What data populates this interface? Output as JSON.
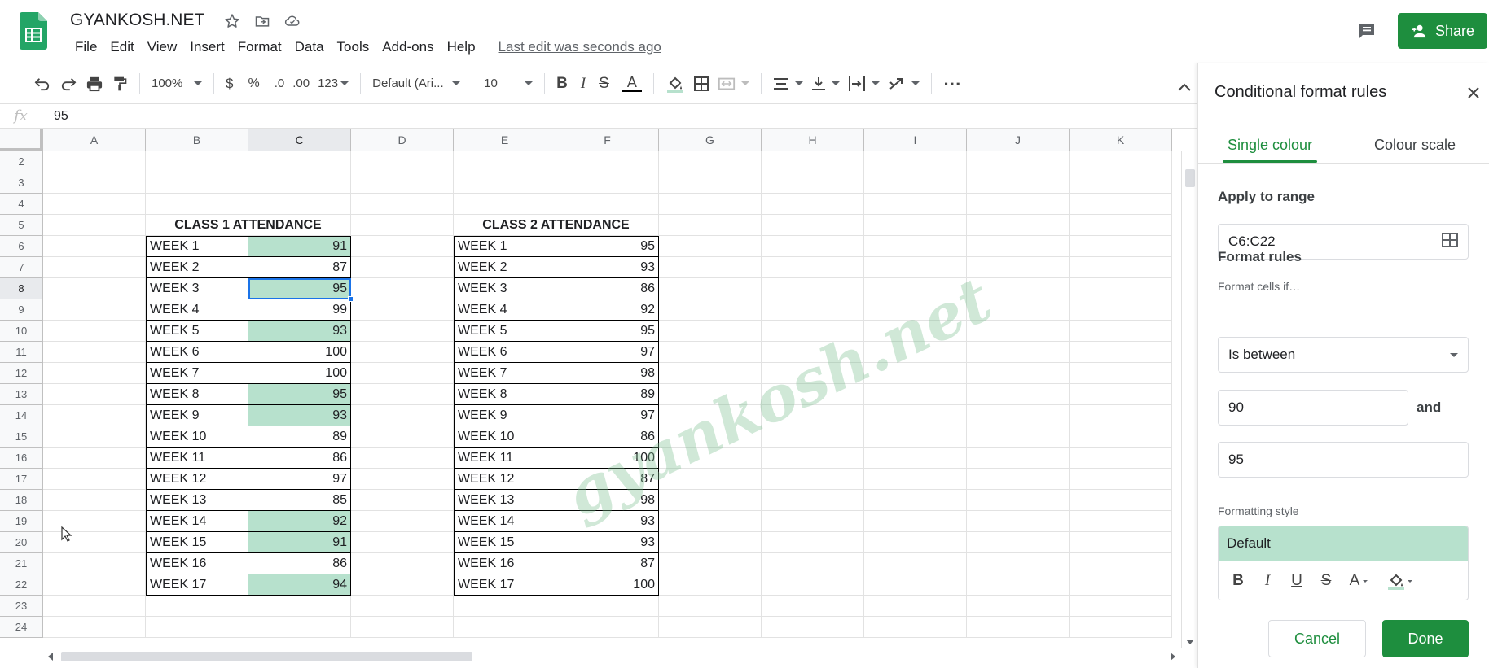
{
  "document": {
    "title": "GYANKOSH.NET",
    "last_edit": "Last edit was seconds ago"
  },
  "menu": [
    "File",
    "Edit",
    "View",
    "Insert",
    "Format",
    "Data",
    "Tools",
    "Add-ons",
    "Help"
  ],
  "share": {
    "label": "Share"
  },
  "toolbar": {
    "zoom": "100%",
    "currency": "$",
    "percent": "%",
    "decrease_decimals": ".0",
    "increase_decimals": ".00",
    "more_formats": "123",
    "font": "Default (Ari...",
    "font_size": "10",
    "bold": "B",
    "italic": "I",
    "strikethrough": "S",
    "text_color": "A",
    "more": "⋯"
  },
  "formula_bar": {
    "fx": "fx",
    "value": "95"
  },
  "grid": {
    "columns": [
      "A",
      "B",
      "C",
      "D",
      "E",
      "F",
      "G",
      "H",
      "I",
      "J",
      "K"
    ],
    "selected_column": "C",
    "selected_row": "8",
    "rows": [
      {
        "n": "2",
        "b": "",
        "c": "",
        "e": "",
        "f": ""
      },
      {
        "n": "3",
        "b": "",
        "c": "",
        "e": "",
        "f": ""
      },
      {
        "n": "4",
        "b": "",
        "c": "",
        "e": "",
        "f": ""
      },
      {
        "n": "5",
        "b": "CLASS 1 ATTENDANCE",
        "c": "",
        "e": "CLASS 2 ATTENDANCE",
        "f": ""
      },
      {
        "n": "6",
        "b": "WEEK 1",
        "c": "91",
        "e": "WEEK 1",
        "f": "95"
      },
      {
        "n": "7",
        "b": "WEEK 2",
        "c": "87",
        "e": "WEEK 2",
        "f": "93"
      },
      {
        "n": "8",
        "b": "WEEK 3",
        "c": "95",
        "e": "WEEK 3",
        "f": "86"
      },
      {
        "n": "9",
        "b": "WEEK 4",
        "c": "99",
        "e": "WEEK 4",
        "f": "92"
      },
      {
        "n": "10",
        "b": "WEEK 5",
        "c": "93",
        "e": "WEEK 5",
        "f": "95"
      },
      {
        "n": "11",
        "b": "WEEK 6",
        "c": "100",
        "e": "WEEK 6",
        "f": "97"
      },
      {
        "n": "12",
        "b": "WEEK 7",
        "c": "100",
        "e": "WEEK 7",
        "f": "98"
      },
      {
        "n": "13",
        "b": "WEEK 8",
        "c": "95",
        "e": "WEEK 8",
        "f": "89"
      },
      {
        "n": "14",
        "b": "WEEK 9",
        "c": "93",
        "e": "WEEK 9",
        "f": "97"
      },
      {
        "n": "15",
        "b": "WEEK 10",
        "c": "89",
        "e": "WEEK 10",
        "f": "86"
      },
      {
        "n": "16",
        "b": "WEEK 11",
        "c": "86",
        "e": "WEEK 11",
        "f": "100"
      },
      {
        "n": "17",
        "b": "WEEK 12",
        "c": "97",
        "e": "WEEK 12",
        "f": "87"
      },
      {
        "n": "18",
        "b": "WEEK 13",
        "c": "85",
        "e": "WEEK 13",
        "f": "98"
      },
      {
        "n": "19",
        "b": "WEEK 14",
        "c": "92",
        "e": "WEEK 14",
        "f": "93"
      },
      {
        "n": "20",
        "b": "WEEK 15",
        "c": "91",
        "e": "WEEK 15",
        "f": "93"
      },
      {
        "n": "21",
        "b": "WEEK 16",
        "c": "86",
        "e": "WEEK 16",
        "f": "87"
      },
      {
        "n": "22",
        "b": "WEEK 17",
        "c": "94",
        "e": "WEEK 17",
        "f": "100"
      },
      {
        "n": "23",
        "b": "",
        "c": "",
        "e": "",
        "f": ""
      },
      {
        "n": "24",
        "b": "",
        "c": "",
        "e": "",
        "f": ""
      }
    ],
    "highlight_color": "#b7e1cd"
  },
  "watermark": "gyankosh.net",
  "panel": {
    "title": "Conditional format rules",
    "tabs": [
      "Single colour",
      "Colour scale"
    ],
    "active_tab": "Single colour",
    "apply_to_range_label": "Apply to range",
    "range": "C6:C22",
    "format_rules_label": "Format rules",
    "format_cells_if_label": "Format cells if…",
    "condition": "Is between",
    "value_from": "90",
    "and_label": "and",
    "value_to": "95",
    "formatting_style_label": "Formatting style",
    "style_preview": "Default",
    "style_tools": {
      "bold": "B",
      "italic": "I",
      "underline": "U",
      "strikethrough": "S",
      "text_color": "A"
    },
    "cancel": "Cancel",
    "done": "Done"
  },
  "colors": {
    "brand_green": "#1e8e3e",
    "highlight_green": "#b7e1cd",
    "selection_blue": "#1a73e8"
  },
  "icons": [
    "sheets-logo-icon",
    "star-icon",
    "move-to-folder-icon",
    "cloud-saved-icon",
    "comment-icon",
    "share-person-icon",
    "undo-icon",
    "redo-icon",
    "print-icon",
    "paint-format-icon",
    "fill-color-icon",
    "borders-icon",
    "merge-cells-icon",
    "horizontal-align-icon",
    "vertical-align-icon",
    "text-wrap-icon",
    "text-rotation-icon",
    "collapse-icon",
    "close-icon",
    "range-grid-icon",
    "dropdown-caret-icon",
    "mouse-cursor-icon"
  ]
}
